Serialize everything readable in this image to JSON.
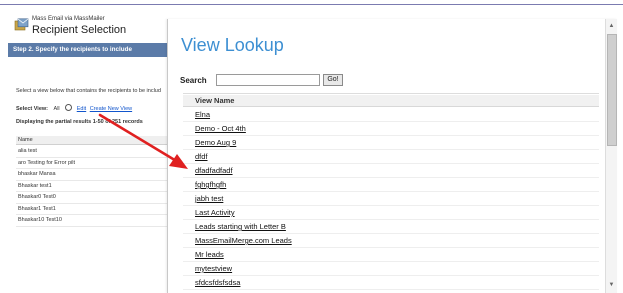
{
  "background_page": {
    "app_subtitle": "Mass Email via MassMailer",
    "app_title": "Recipient Selection",
    "step_title": "Step 2. Specify the recipients to include",
    "instructions": "Select a view below that contains the recipients to be includ",
    "select_view_label": "Select View:",
    "select_view_value": "All",
    "edit_link": "Edit",
    "create_view_link": "Create New View",
    "display_info": "Displaying the partial results 1-50 of 251 records",
    "column_header": "Name",
    "records": [
      "alia test",
      "aro Testing for Error pilt",
      "bhaskar Mansa",
      "Bhaskar test1",
      "Bhaskar0 Test0",
      "Bhaskar1 Test1",
      "Bhaskar10 Test10"
    ]
  },
  "popup": {
    "title": "View Lookup",
    "search_label": "Search",
    "search_value": "",
    "go_label": "Go!",
    "column_header": "View Name",
    "results": [
      "Elna",
      "Demo - Oct 4th",
      "Demo Aug 9",
      "dfdf",
      "dfadfadfadf",
      "fghgfhgfh",
      "jabh test",
      "Last Activity",
      "Leads starting with Letter B",
      "MassEmailMerge.com Leads",
      "Mr leads",
      "mytestview",
      "sfdcsfdsfsdsa"
    ]
  },
  "colors": {
    "accent": "#3d8fd2",
    "step_bar": "#5b7ba8",
    "arrow": "#e02020"
  },
  "icons": [
    "app-logo-icon",
    "magnifier-icon",
    "scroll-up-arrow-icon",
    "scroll-down-arrow-icon",
    "annotation-arrow"
  ]
}
